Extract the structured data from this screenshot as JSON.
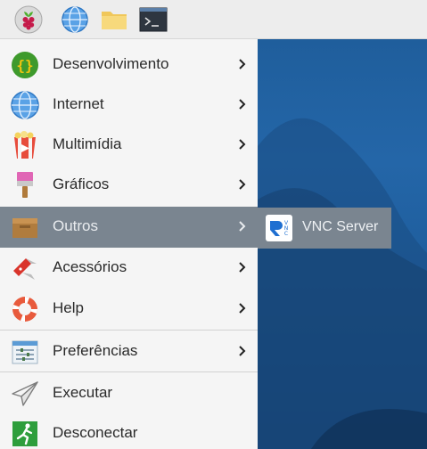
{
  "taskbar": {
    "icons": [
      "raspberry-pi-icon",
      "globe-icon",
      "folder-icon",
      "terminal-icon"
    ]
  },
  "menu": {
    "items": [
      {
        "label": "Desenvolvimento",
        "icon": "code-braces-icon",
        "has_submenu": true
      },
      {
        "label": "Internet",
        "icon": "globe-icon",
        "has_submenu": true
      },
      {
        "label": "Multimídia",
        "icon": "popcorn-film-icon",
        "has_submenu": true
      },
      {
        "label": "Gráficos",
        "icon": "paintbrush-icon",
        "has_submenu": true
      },
      {
        "label": "Outros",
        "icon": "box-icon",
        "has_submenu": true,
        "selected": true
      },
      {
        "label": "Acessórios",
        "icon": "swiss-knife-icon",
        "has_submenu": true
      },
      {
        "label": "Help",
        "icon": "lifebuoy-icon",
        "has_submenu": true
      },
      {
        "label": "Preferências",
        "icon": "sliders-icon",
        "has_submenu": true
      },
      {
        "label": "Executar",
        "icon": "paper-plane-icon",
        "has_submenu": false
      },
      {
        "label": "Desconectar",
        "icon": "exit-running-icon",
        "has_submenu": false
      }
    ]
  },
  "submenu": {
    "items": [
      {
        "label": "VNC Server",
        "icon": "vnc-logo-icon"
      }
    ]
  },
  "colors": {
    "menu_bg": "#f5f5f5",
    "selected_bg": "#7a8590",
    "desktop_blue": "#1f5e9c",
    "taskbar_bg": "#ededed"
  }
}
